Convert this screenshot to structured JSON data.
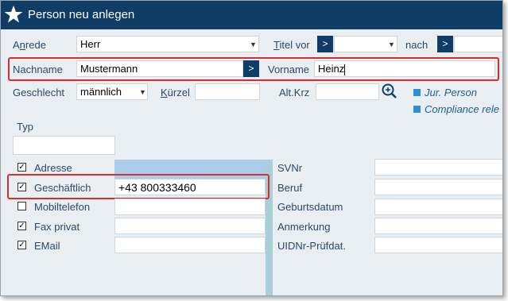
{
  "window": {
    "title": "Person neu anlegen"
  },
  "row1": {
    "anrede_label": "Anrede",
    "anrede_value": "Herr",
    "titel_vor_label": "Titel vor",
    "titel_vor_btn": ">",
    "titel_vor_value": "",
    "nach_label": "nach",
    "nach_btn": ">",
    "nach_value": ""
  },
  "row2": {
    "nachname_label": "Nachname",
    "nachname_value": "Mustermann",
    "nachname_btn": ">",
    "vorname_label": "Vorname",
    "vorname_value": "Heinz"
  },
  "row3": {
    "geschlecht_label": "Geschlecht",
    "geschlecht_value": "männlich",
    "kuerzel_label": "Kürzel",
    "kuerzel_value": "",
    "altkrz_label": "Alt.Krz",
    "altkrz_value": "",
    "jur_person_label": "Jur. Person",
    "compliance_label": "Compliance rele"
  },
  "typ": {
    "label": "Typ",
    "value": ""
  },
  "contacts": [
    {
      "label": "Adresse",
      "checked": true,
      "value": ""
    },
    {
      "label": "Geschäftlich",
      "checked": true,
      "value": "+43  800333460"
    },
    {
      "label": "Mobiltelefon",
      "checked": false,
      "value": ""
    },
    {
      "label": "Fax privat",
      "checked": true,
      "value": ""
    },
    {
      "label": "EMail",
      "checked": true,
      "value": ""
    }
  ],
  "details": [
    {
      "label": "SVNr",
      "value": ""
    },
    {
      "label": "Beruf",
      "value": ""
    },
    {
      "label": "Geburtsdatum",
      "value": ""
    },
    {
      "label": "Anmerkung",
      "value": ""
    },
    {
      "label": "UIDNr-Prüfdat.",
      "value": ""
    }
  ],
  "colors": {
    "titlebar": "#0f3d66",
    "highlight": "#d32f2f",
    "accent": "#2f8fd0",
    "selected_row": "#a9cdeb"
  },
  "icons": {
    "title": "star-icon",
    "search": "magnifier-plus-icon"
  }
}
